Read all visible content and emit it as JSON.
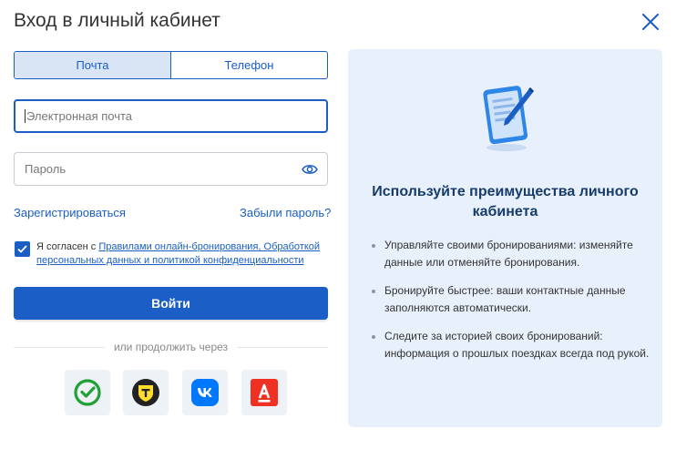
{
  "dialog": {
    "title": "Вход в личный кабинет",
    "close_icon": "close-icon"
  },
  "tabs": [
    {
      "label": "Почта",
      "active": true
    },
    {
      "label": "Телефон",
      "active": false
    }
  ],
  "form": {
    "email_placeholder": "Электронная почта",
    "email_value": "",
    "password_placeholder": "Пароль",
    "password_value": "",
    "password_toggle_icon": "eye-icon",
    "register_link": "Зарегистрироваться",
    "forgot_link": "Забыли пароль?",
    "consent_checked": true,
    "consent_prefix": "Я согласен с ",
    "consent_link": "Правилами онлайн-бронирования, Обработкой персональных данных и политикой конфиденциальности",
    "login_button": "Войти",
    "divider_text": "или продолжить через"
  },
  "social": [
    {
      "name": "sber",
      "icon": "sber-icon",
      "color": "#21a038"
    },
    {
      "name": "tinkoff",
      "icon": "tinkoff-icon",
      "color": "#ffdd2d"
    },
    {
      "name": "vk",
      "icon": "vk-icon",
      "color": "#0077ff"
    },
    {
      "name": "alfa",
      "icon": "alfa-icon",
      "color": "#ef3124"
    }
  ],
  "panel": {
    "icon": "tablet-pen-icon",
    "title": "Используйте преимущества личного кабинета",
    "benefits": [
      "Управляйте своими бронированиями: изменяйте данные или отменяйте бронирования.",
      "Бронируйте быстрее: ваши контактные данные заполняются автоматически.",
      "Следите за историей своих бронирований: информация о прошлых поездках всегда под рукой."
    ]
  },
  "colors": {
    "accent": "#1a5ec6",
    "panel_bg": "#e8f0fb",
    "panel_title": "#173c6b"
  }
}
